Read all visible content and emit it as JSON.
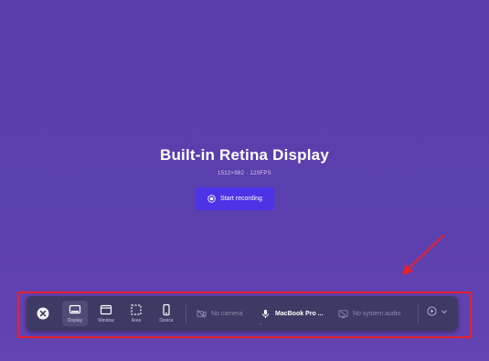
{
  "screen": {
    "title": "Built-in Retina Display",
    "resolution": "1512×982 · 120FPS",
    "start_button": "Start recording"
  },
  "toolbar": {
    "close_icon": "close-icon",
    "modes": [
      {
        "label": "Display",
        "icon": "display-icon",
        "active": true
      },
      {
        "label": "Window",
        "icon": "window-icon",
        "active": false
      },
      {
        "label": "Area",
        "icon": "area-icon",
        "active": false
      },
      {
        "label": "Device",
        "icon": "device-icon",
        "active": false
      }
    ],
    "camera": "No camera",
    "microphone": "MacBook Pro ...",
    "system_audio": "No system audio"
  },
  "colors": {
    "background": "#5a3eaa",
    "accent_button": "#4d33e6",
    "toolbar": "#3e3a63",
    "annotation": "#e8202a"
  }
}
